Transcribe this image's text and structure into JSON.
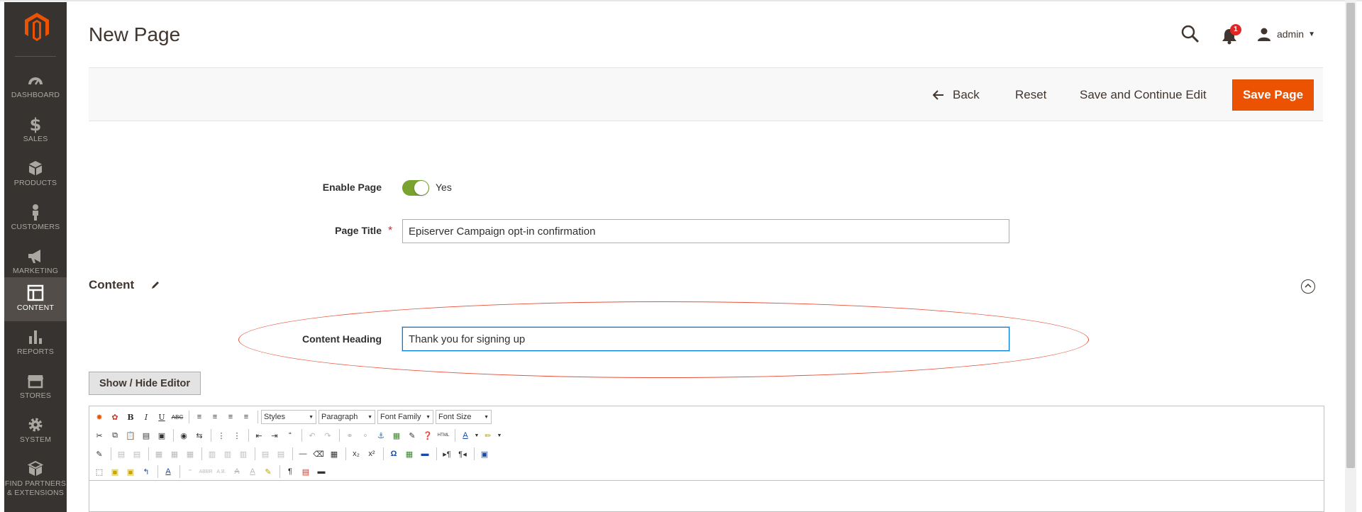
{
  "sidebar": {
    "logo": "magento-logo-icon",
    "items": [
      {
        "label": "DASHBOARD",
        "icon": "dashboard-icon"
      },
      {
        "label": "SALES",
        "icon": "dollar-icon"
      },
      {
        "label": "PRODUCTS",
        "icon": "cube-icon"
      },
      {
        "label": "CUSTOMERS",
        "icon": "person-icon"
      },
      {
        "label": "MARKETING",
        "icon": "megaphone-icon"
      },
      {
        "label": "CONTENT",
        "icon": "layout-icon",
        "active": true
      },
      {
        "label": "REPORTS",
        "icon": "bar-chart-icon"
      },
      {
        "label": "STORES",
        "icon": "store-icon"
      },
      {
        "label": "SYSTEM",
        "icon": "gear-icon"
      },
      {
        "label": "FIND PARTNERS & EXTENSIONS",
        "icon": "box-icon"
      }
    ]
  },
  "header": {
    "title": "New Page",
    "notification_count": "1",
    "user": "admin"
  },
  "actions": {
    "back": "Back",
    "reset": "Reset",
    "save_continue": "Save and Continue Edit",
    "save": "Save Page"
  },
  "form": {
    "enable_page": {
      "label": "Enable Page",
      "value": "Yes",
      "on": true
    },
    "page_title": {
      "label": "Page Title",
      "value": "Episerver Campaign opt-in confirmation"
    }
  },
  "content": {
    "section_title": "Content",
    "heading_label": "Content Heading",
    "heading_value": "Thank you for signing up",
    "show_hide_editor": "Show / Hide Editor"
  },
  "editor": {
    "styles": "Styles",
    "paragraph": "Paragraph",
    "font_family": "Font Family",
    "font_size": "Font Size"
  },
  "colors": {
    "sidebar": "#373330",
    "accent": "#eb5202",
    "toggle_on": "#79a22e",
    "annotation": "#e8503a"
  }
}
